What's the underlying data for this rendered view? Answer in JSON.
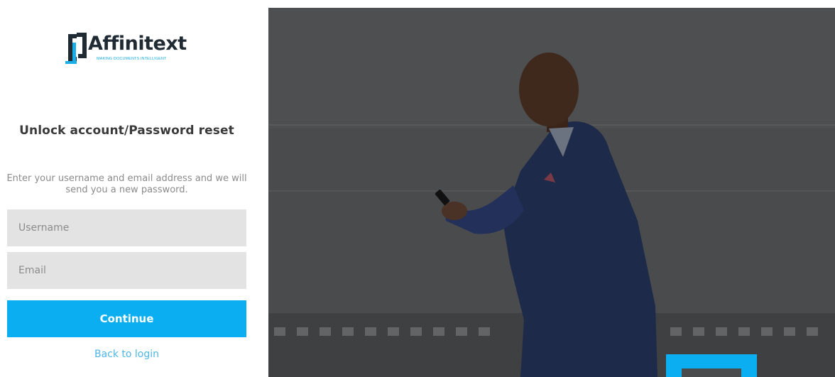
{
  "brand": {
    "name": "Affinitext",
    "tagline": "MAKING DOCUMENTS INTELLIGENT",
    "accent_color": "#0baef0"
  },
  "form": {
    "title": "Unlock account/Password reset",
    "instructions": "Enter your username and email address and we will send you a new password.",
    "username_placeholder": "Username",
    "email_placeholder": "Email",
    "continue_label": "Continue",
    "back_label": "Back to login"
  },
  "hero": {
    "image_semantic": "man-smiling-at-phone-photo"
  }
}
